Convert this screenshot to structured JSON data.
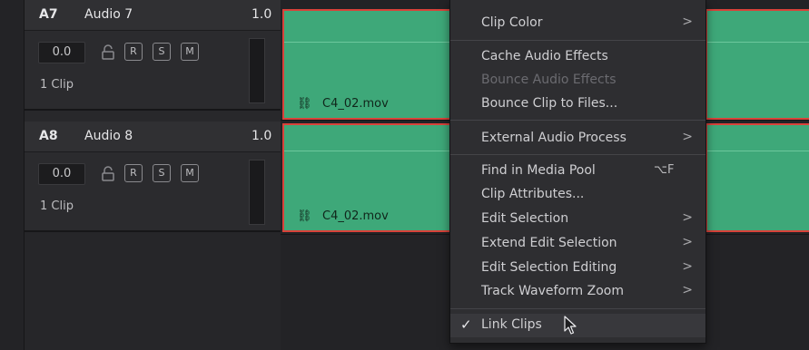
{
  "tracks": [
    {
      "id": "A7",
      "name": "Audio 7",
      "level": "1.0",
      "volume": "0.0",
      "rsm": [
        "R",
        "S",
        "M"
      ],
      "clip_count": "1 Clip",
      "clip_name": "C4_02.mov"
    },
    {
      "id": "A8",
      "name": "Audio 8",
      "level": "1.0",
      "volume": "0.0",
      "rsm": [
        "R",
        "S",
        "M"
      ],
      "clip_count": "1 Clip",
      "clip_name": "C4_02.mov"
    }
  ],
  "context_menu": {
    "items": [
      {
        "label": "Clip Color",
        "submenu": true
      },
      {
        "label": "Cache Audio Effects"
      },
      {
        "label": "Bounce Audio Effects",
        "disabled": true
      },
      {
        "label": "Bounce Clip to Files..."
      },
      {
        "label": "External Audio Process",
        "submenu": true
      },
      {
        "label": "Find in Media Pool",
        "shortcut": "⌥F"
      },
      {
        "label": "Clip Attributes..."
      },
      {
        "label": "Edit Selection",
        "submenu": true
      },
      {
        "label": "Extend Edit Selection",
        "submenu": true
      },
      {
        "label": "Edit Selection Editing",
        "submenu": true
      },
      {
        "label": "Track Waveform Zoom",
        "submenu": true
      },
      {
        "label": "Link Clips",
        "checked": true
      }
    ],
    "chevron": ">",
    "check_glyph": "✓"
  },
  "colors": {
    "clip": "#3ea879",
    "clip_border": "#d9423a",
    "menu_bg": "#2e2e31"
  }
}
